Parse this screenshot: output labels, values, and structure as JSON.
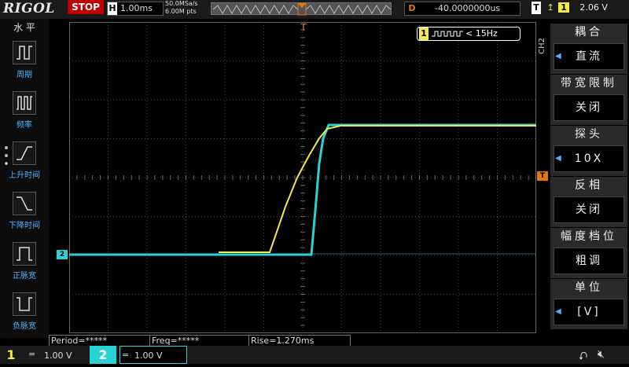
{
  "topbar": {
    "brand": "RIGOL",
    "run_status": "STOP",
    "horizontal_tag": "H",
    "timebase": "1.00ms",
    "sample_rate": "50.0MSa/s",
    "memory_depth": "6.00M pts",
    "delay_tag": "D",
    "delay_value": "-40.0000000us",
    "trigger_tag": "T",
    "trigger_level": "2.06 V"
  },
  "left_panel": {
    "header": "水 平",
    "items": [
      {
        "label": "周期",
        "icon": "period-icon"
      },
      {
        "label": "频率",
        "icon": "frequency-icon"
      },
      {
        "label": "上升时间",
        "icon": "rise-time-icon"
      },
      {
        "label": "下降时间",
        "icon": "fall-time-icon"
      },
      {
        "label": "正脉宽",
        "icon": "positive-width-icon"
      },
      {
        "label": "负脉宽",
        "icon": "negative-width-icon"
      }
    ]
  },
  "freq_counter": {
    "channel": "1",
    "text": "< 15Hz"
  },
  "right_menu": {
    "channel": "CH2",
    "items": [
      {
        "title": "耦合",
        "value": "直流",
        "arrow": "◀"
      },
      {
        "title": "带宽限制",
        "value": "关闭",
        "arrow": ""
      },
      {
        "title": "探头",
        "value": "10X",
        "arrow": "◀"
      },
      {
        "title": "反相",
        "value": "关闭",
        "arrow": ""
      },
      {
        "title": "幅度档位",
        "value": "粗调",
        "arrow": ""
      },
      {
        "title": "单位",
        "value": "[V]",
        "arrow": "◀"
      }
    ]
  },
  "markers": {
    "ch2_ground": "2",
    "trigger_level": "T"
  },
  "measurements": {
    "period": "Period=*****",
    "freq": "Freq=*****",
    "rise": "Rise=1.270ms"
  },
  "bottom": {
    "ch1_tag": "1",
    "ch1_scale": "1.00 V",
    "ch2_tag": "2",
    "ch2_scale": "1.00 V",
    "usb_icon": "usb-icon",
    "speaker_icon": "speaker-icon"
  },
  "colors": {
    "ch1": "#f2e94e",
    "ch2": "#2ad2d6",
    "accent_blue": "#4fb4ff",
    "stop_red": "#c00000",
    "trigger_orange": "#e07a10"
  }
}
